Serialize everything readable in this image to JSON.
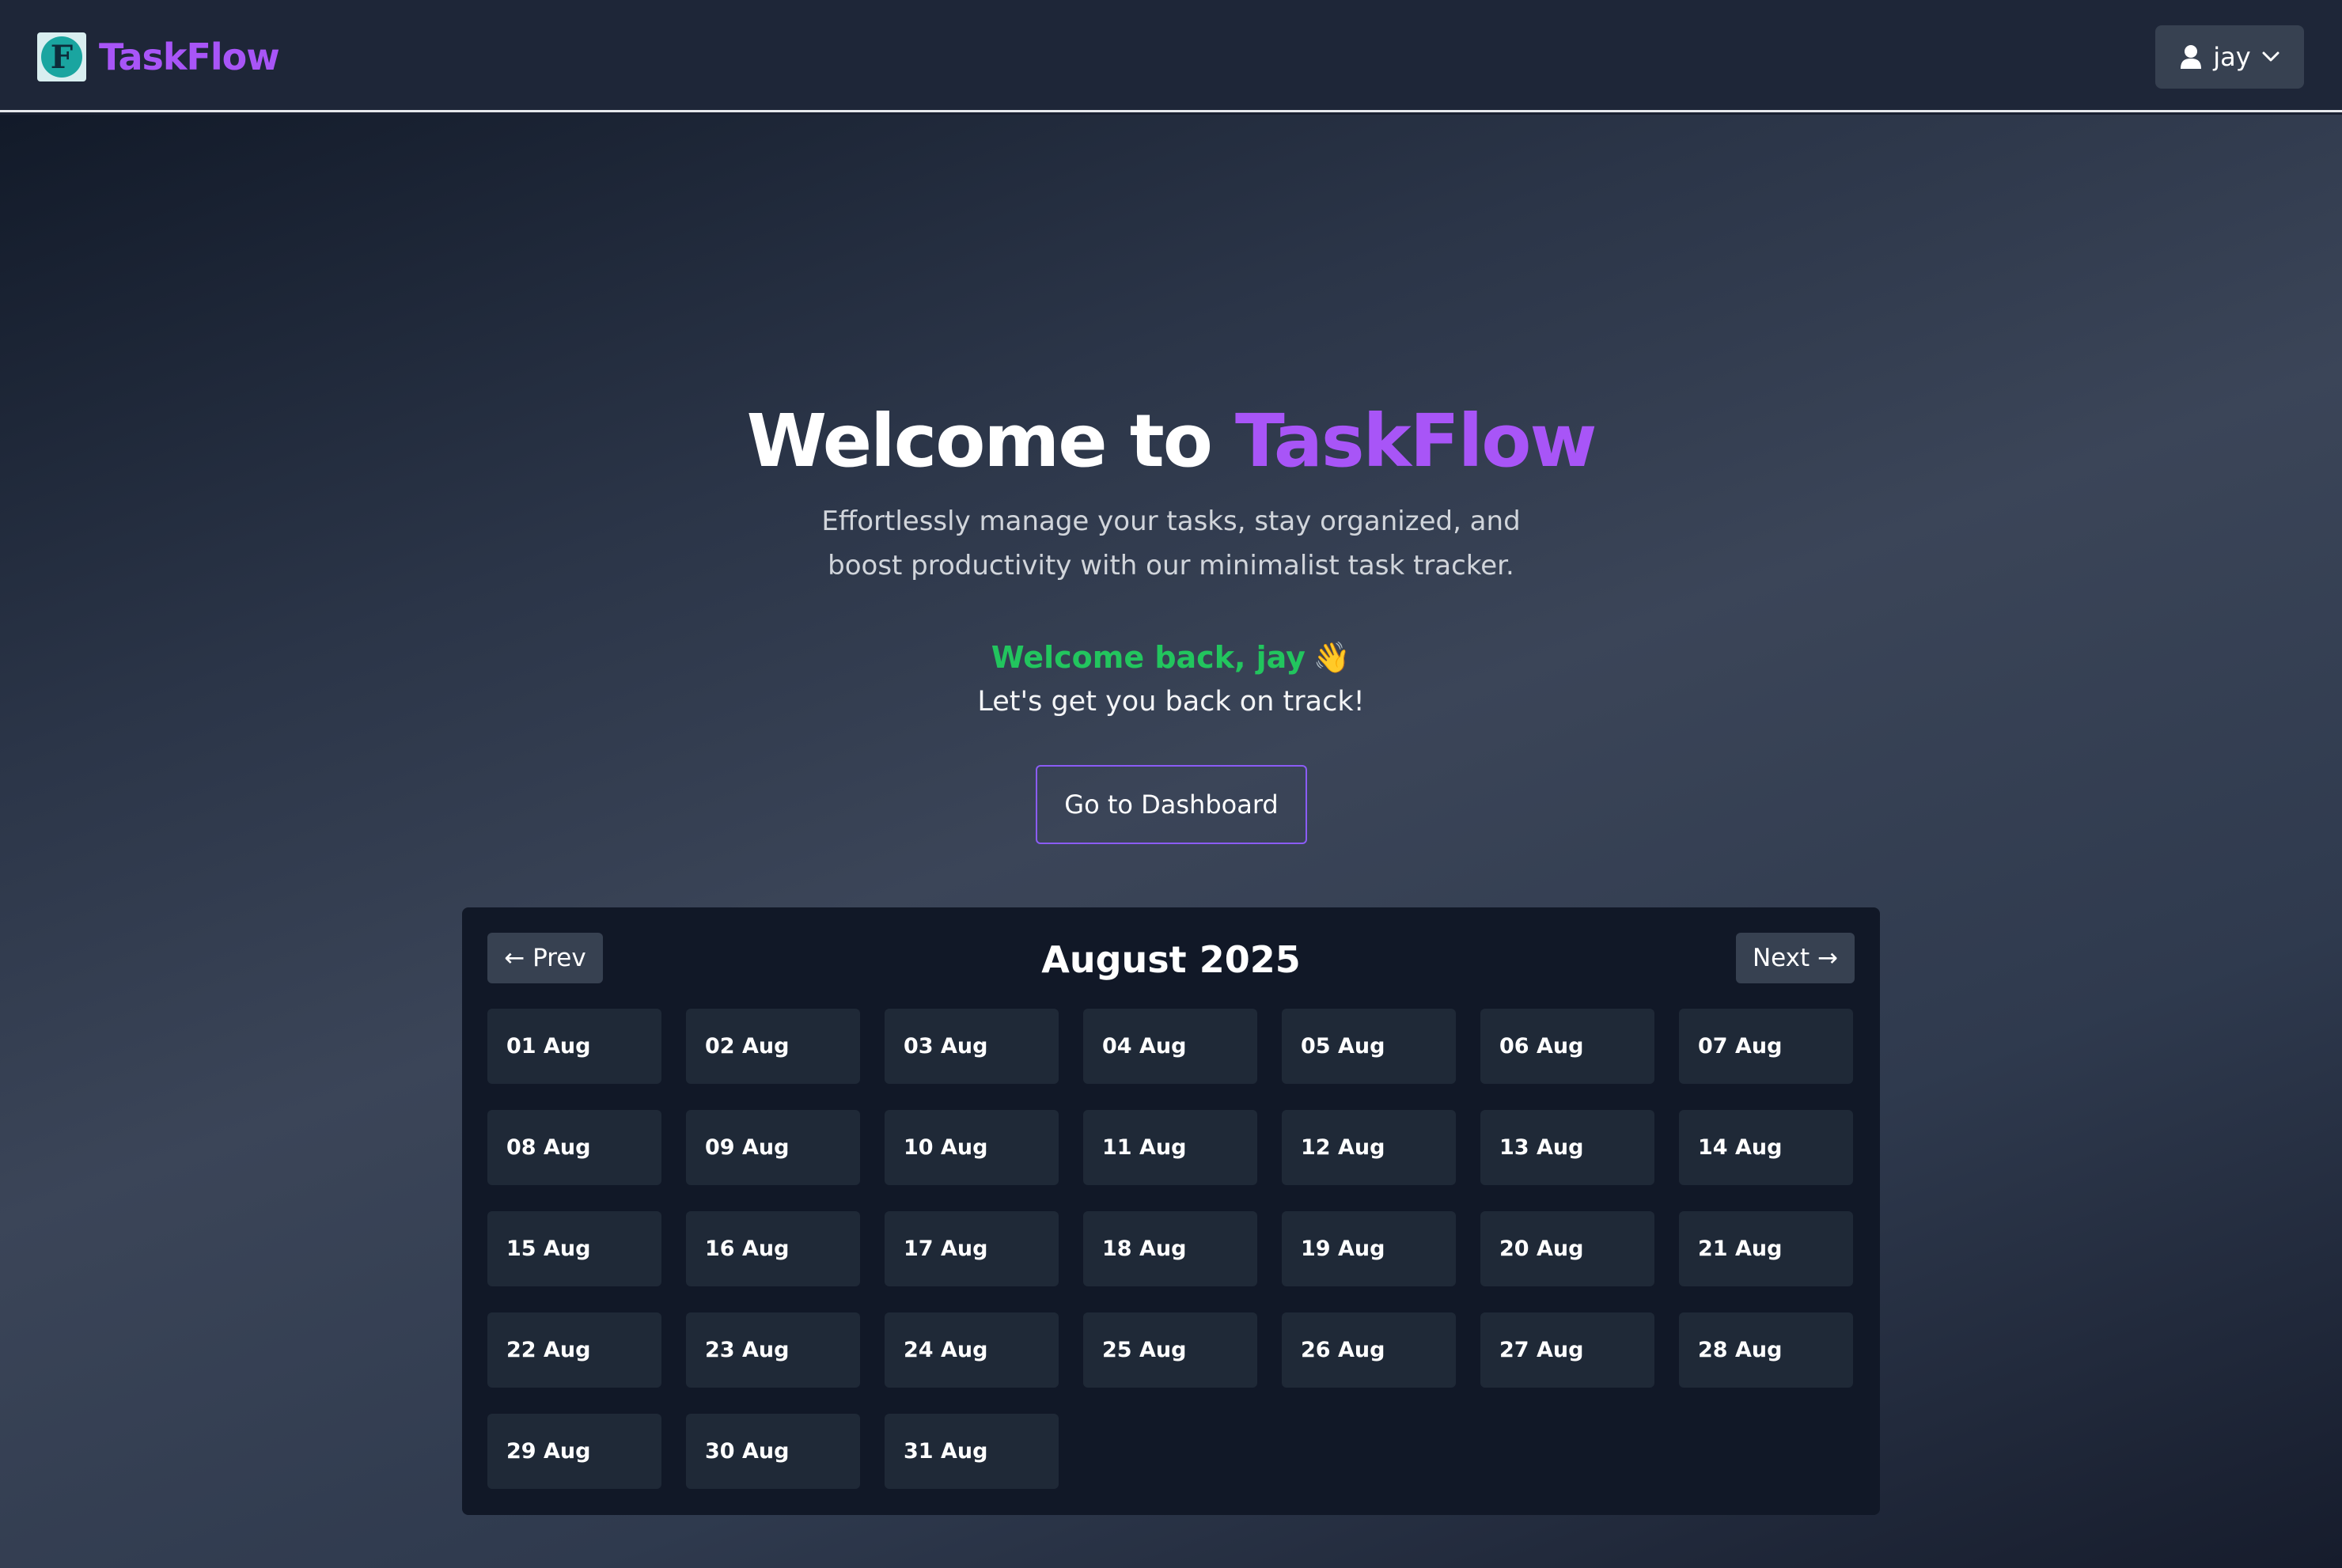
{
  "navbar": {
    "logo_letter": "F",
    "brand": "TaskFlow",
    "user": "jay"
  },
  "hero": {
    "title_prefix": "Welcome to",
    "title_accent": "TaskFlow",
    "subtitle": "Effortlessly manage your tasks, stay organized, and boost productivity with our minimalist task tracker.",
    "welcome_back": "Welcome back, jay",
    "wave_emoji": "👋",
    "tagline": "Let's get you back on track!",
    "dashboard_button": "Go to Dashboard"
  },
  "calendar": {
    "prev_label": "← Prev",
    "next_label": "Next →",
    "month_title": "August 2025",
    "days": [
      "01 Aug",
      "02 Aug",
      "03 Aug",
      "04 Aug",
      "05 Aug",
      "06 Aug",
      "07 Aug",
      "08 Aug",
      "09 Aug",
      "10 Aug",
      "11 Aug",
      "12 Aug",
      "13 Aug",
      "14 Aug",
      "15 Aug",
      "16 Aug",
      "17 Aug",
      "18 Aug",
      "19 Aug",
      "20 Aug",
      "21 Aug",
      "22 Aug",
      "23 Aug",
      "24 Aug",
      "25 Aug",
      "26 Aug",
      "27 Aug",
      "28 Aug",
      "29 Aug",
      "30 Aug",
      "31 Aug"
    ]
  },
  "colors": {
    "accent": "#a855f7",
    "success": "#22c55e",
    "panel": "#111827",
    "tile": "#1f2937"
  }
}
